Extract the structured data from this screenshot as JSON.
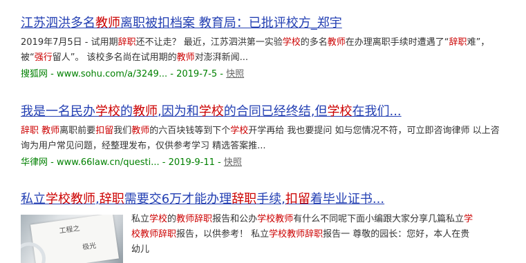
{
  "results": [
    {
      "title": [
        {
          "t": "江苏泗洪多名",
          "h": false
        },
        {
          "t": "教师",
          "h": true
        },
        {
          "t": "离职被扣档案 教育局：已批评校方_郑宇",
          "h": false
        }
      ],
      "snippet": [
        {
          "t": "2019年7月5日 - 试用期",
          "h": false
        },
        {
          "t": "辞职",
          "h": true
        },
        {
          "t": "还不让走？ 最近，江苏泗洪第一实验",
          "h": false
        },
        {
          "t": "学校",
          "h": true
        },
        {
          "t": "的多名",
          "h": false
        },
        {
          "t": "教师",
          "h": true
        },
        {
          "t": "在办理离职手续时遭遇了“",
          "h": false
        },
        {
          "t": "辞职",
          "h": true
        },
        {
          "t": "难”，被“",
          "h": false
        },
        {
          "t": "强行",
          "h": true
        },
        {
          "t": "留人”。 该校多名尚在试用期的",
          "h": false
        },
        {
          "t": "教师",
          "h": true
        },
        {
          "t": "对澎湃新闻...",
          "h": false
        }
      ],
      "source": "搜狐网",
      "url": "www.sohu.com/a/3249...",
      "date": "2019-7-5",
      "kuaizhao": "快照"
    },
    {
      "title": [
        {
          "t": "我是一名民办",
          "h": false
        },
        {
          "t": "学校",
          "h": true
        },
        {
          "t": "的",
          "h": false
        },
        {
          "t": "教师",
          "h": true
        },
        {
          "t": ",因为和",
          "h": false
        },
        {
          "t": "学校",
          "h": true
        },
        {
          "t": "的合同已经终结,但",
          "h": false
        },
        {
          "t": "学校",
          "h": true
        },
        {
          "t": "在我们...",
          "h": false
        }
      ],
      "snippet": [
        {
          "t": "辞职",
          "h": true
        },
        {
          "t": " ",
          "h": false
        },
        {
          "t": "教师",
          "h": true
        },
        {
          "t": "离职前要",
          "h": false
        },
        {
          "t": "扣留",
          "h": true
        },
        {
          "t": "我们",
          "h": false
        },
        {
          "t": "教师",
          "h": true
        },
        {
          "t": "的六百块钱等到下个",
          "h": false
        },
        {
          "t": "学校",
          "h": true
        },
        {
          "t": "开学再给 我也要提问 如与您情况不符，可立即咨询律师 以上咨询为用户常见问题，经整理发布，仅供参考学习 精选答案推...",
          "h": false
        }
      ],
      "source": "华律网",
      "url": "www.66law.cn/questi...",
      "date": "2019-9-11",
      "kuaizhao": "快照"
    },
    {
      "title": [
        {
          "t": "私立",
          "h": false
        },
        {
          "t": "学校教师",
          "h": true
        },
        {
          "t": ",",
          "h": false
        },
        {
          "t": "辞职",
          "h": true
        },
        {
          "t": "需要交6万才能办理",
          "h": false
        },
        {
          "t": "辞职",
          "h": true
        },
        {
          "t": "手续,",
          "h": false
        },
        {
          "t": "扣留",
          "h": true
        },
        {
          "t": "着毕业证书...",
          "h": false
        }
      ],
      "snippet": [
        {
          "t": "私立",
          "h": false
        },
        {
          "t": "学校",
          "h": true
        },
        {
          "t": "的",
          "h": false
        },
        {
          "t": "教师辞职",
          "h": true
        },
        {
          "t": "报告和公办",
          "h": false
        },
        {
          "t": "学校教师",
          "h": true
        },
        {
          "t": "有什么不同呢下面小编跟大家分享几篇私立",
          "h": false
        },
        {
          "t": "学校教师辞职",
          "h": true
        },
        {
          "t": "报告，以供参考！ 私立",
          "h": false
        },
        {
          "t": "学校教师辞职",
          "h": true
        },
        {
          "t": "报告一 尊敬的园长：您好，本人在贵幼儿",
          "h": false
        }
      ],
      "thumb_text": [
        "工程之",
        "极光"
      ]
    }
  ],
  "colors": {
    "link": "#2440b3",
    "highlight": "#cc0000",
    "source": "#008000"
  }
}
